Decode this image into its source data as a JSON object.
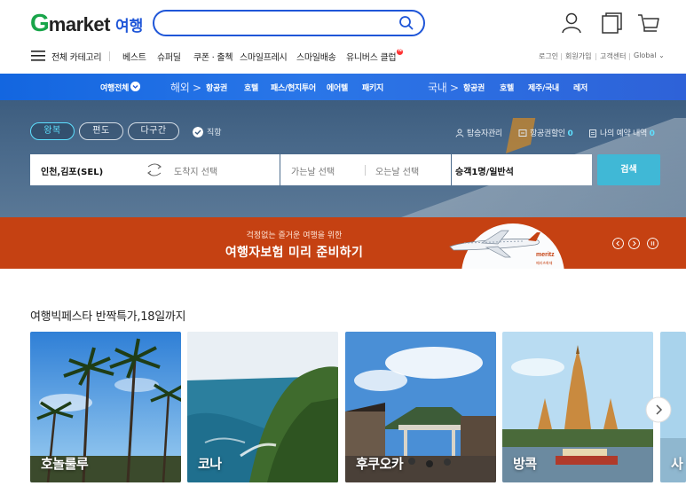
{
  "header": {
    "logo_g": "G",
    "logo_rest": "market",
    "logo_travel": "여행",
    "search_placeholder": "",
    "icons": [
      "user-icon",
      "recent-icon",
      "cart-icon"
    ]
  },
  "nav": {
    "all_categories": "전체 카테고리",
    "items": [
      "베스트",
      "슈퍼딜",
      "쿠폰 · 출첵",
      "스마일프레시",
      "스마일배송",
      "유니버스 클럽"
    ],
    "util": [
      "로그인",
      "회원가입",
      "고객센터",
      "Global"
    ]
  },
  "catbar": {
    "all_travel": "여행전체",
    "overseas": "해외 >",
    "overseas_items": [
      "항공권",
      "호텔",
      "패스/현지투어",
      "에어텔",
      "패키지"
    ],
    "domestic": "국내 >",
    "domestic_items": [
      "항공권",
      "호텔",
      "제주/국내",
      "레저"
    ]
  },
  "booking": {
    "trip_types": [
      "왕복",
      "편도",
      "다구간"
    ],
    "active_trip": "왕복",
    "direct": "직항",
    "links": [
      {
        "label": "탑승자관리",
        "count": ""
      },
      {
        "label": "항공권할인",
        "count": "0"
      },
      {
        "label": "나의 예약 내역",
        "count": "0"
      }
    ],
    "origin": "인천,김포(SEL)",
    "destination_placeholder": "도착지 선택",
    "depart_placeholder": "가는날 선택",
    "return_placeholder": "오는날 선택",
    "passengers": "승객1명/일반석",
    "search_label": "검색"
  },
  "banner": {
    "sub": "걱정없는 즐거운 여행을 위한",
    "main": "여행자보험 미리 준비하기",
    "brand": "meritz",
    "brand_sub": "메리츠화재"
  },
  "promo": {
    "title": "여행빅페스타 반짝특가,18일까지",
    "cards": [
      {
        "city": "호놀룰루"
      },
      {
        "city": "코나"
      },
      {
        "city": "후쿠오카"
      },
      {
        "city": "방콕"
      },
      {
        "city": "사"
      }
    ]
  },
  "colors": {
    "brand_green": "#19a54a",
    "brand_blue": "#1f56d8",
    "accent_cyan": "#5ee0ff",
    "search_button": "#40b8d6",
    "banner_orange": "#c54112"
  }
}
